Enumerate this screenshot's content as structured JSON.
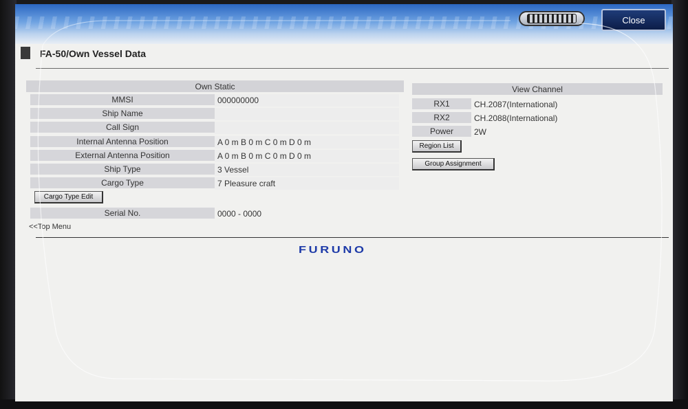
{
  "window": {
    "title": "FA-50/Own Vessel Data",
    "close_label": "Close",
    "keyboard_icon": "keyboard-icon"
  },
  "own_static": {
    "header": "Own Static",
    "rows": [
      {
        "label": "MMSI",
        "value": "000000000"
      },
      {
        "label": "Ship Name",
        "value": ""
      },
      {
        "label": "Call Sign",
        "value": ""
      },
      {
        "label": "Internal Antenna Position",
        "value": "A 0 m B 0 m C 0 m D 0 m"
      },
      {
        "label": "External Antenna Position",
        "value": "A 0 m B 0 m C 0 m D 0 m"
      },
      {
        "label": "Ship Type",
        "value": "3 Vessel"
      },
      {
        "label": "Cargo Type",
        "value": "7 Pleasure craft"
      }
    ],
    "cargo_edit_label": "Cargo Type Edit",
    "serial_label": "Serial No.",
    "serial_value": "0000 - 0000"
  },
  "view_channel": {
    "header": "View Channel",
    "rows": [
      {
        "label": "RX1",
        "value": "CH.2087(International)"
      },
      {
        "label": "RX2",
        "value": "CH.2088(International)"
      },
      {
        "label": "Power",
        "value": "2W"
      }
    ],
    "region_list_label": "Region List",
    "group_assignment_label": "Group Assignment"
  },
  "footer": {
    "top_menu_label": "<<Top Menu",
    "brand": "FURUNO"
  },
  "colors": {
    "title_bar": "#2b67c2",
    "close_button": "#0c1d48",
    "brand": "#1d3aa8",
    "label_cell": "#d6d6da"
  }
}
